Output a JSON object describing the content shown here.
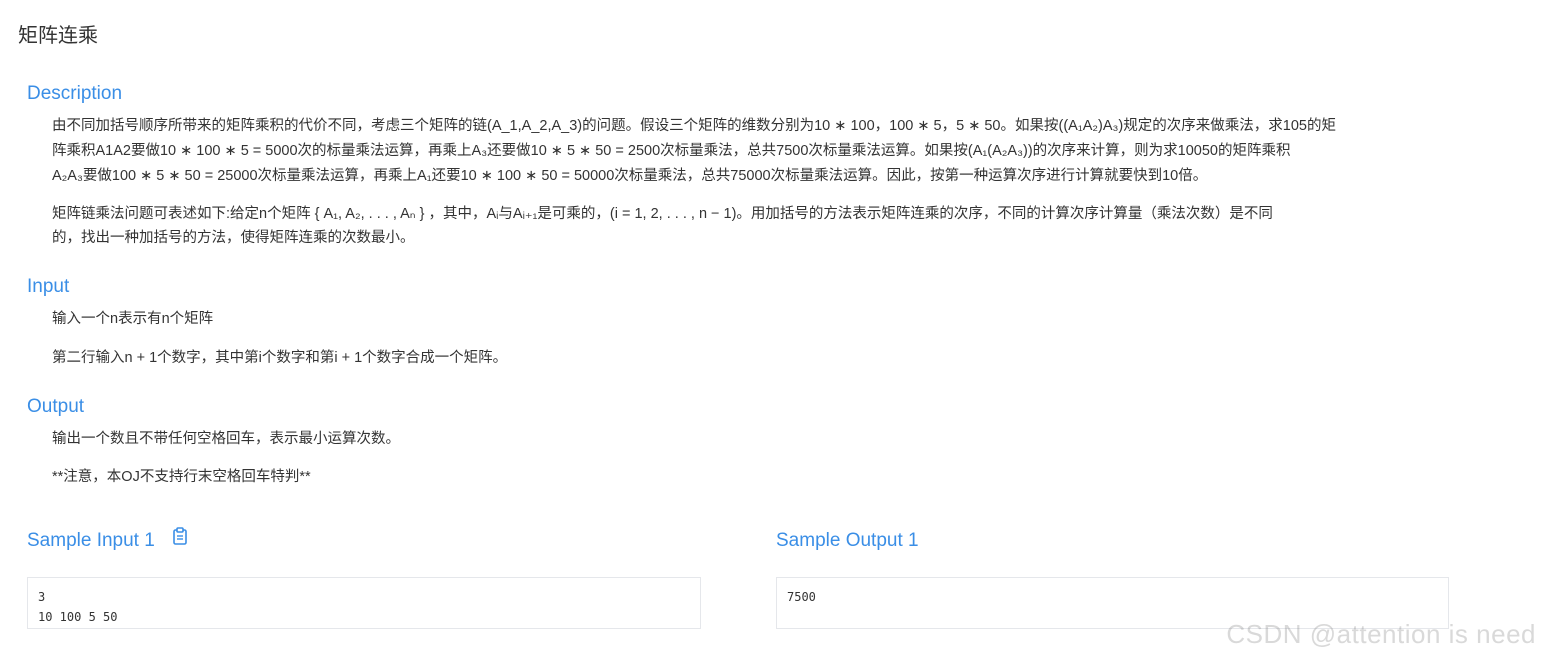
{
  "problem": {
    "title": "矩阵连乘"
  },
  "description": {
    "heading": "Description",
    "para1_lines": [
      "由不同加括号顺序所带来的矩阵乘积的代价不同，考虑三个矩阵的链(A_1,A_2,A_3)的问题。假设三个矩阵的维数分别为10 ∗ 100，100 ∗ 5，5 ∗ 50。如果按((A₁A₂)A₃)规定的次序来做乘法，求105的矩",
      "阵乘积A1A2要做10 ∗ 100 ∗ 5 = 5000次的标量乘法运算，再乘上A₃还要做10 ∗ 5 ∗ 50 = 2500次标量乘法，总共7500次标量乘法运算。如果按(A₁(A₂A₃))的次序来计算，则为求10050的矩阵乘积",
      "A₂A₃要做100 ∗ 5 ∗ 50 = 25000次标量乘法运算，再乘上A₁还要10 ∗ 100 ∗ 50 = 50000次标量乘法，总共75000次标量乘法运算。因此，按第一种运算次序进行计算就要快到10倍。"
    ],
    "para2_lines": [
      "矩阵链乘法问题可表述如下:给定n个矩阵 { A₁, A₂, . . . , Aₙ } ，其中，Aᵢ与Aᵢ₊₁是可乘的，(i = 1, 2, . . . , n − 1)。用加括号的方法表示矩阵连乘的次序，不同的计算次序计算量（乘法次数）是不同",
      "的，找出一种加括号的方法，使得矩阵连乘的次数最小。"
    ]
  },
  "input": {
    "heading": "Input",
    "line1": "输入一个n表示有n个矩阵",
    "line2": "第二行输入n + 1个数字，其中第i个数字和第i + 1个数字合成一个矩阵。"
  },
  "output": {
    "heading": "Output",
    "line1": "输出一个数且不带任何空格回车，表示最小运算次数。",
    "line2": "**注意，本OJ不支持行末空格回车特判**"
  },
  "sample_input": {
    "heading": "Sample Input 1",
    "copy_icon": "clipboard-icon",
    "lines": [
      "3",
      "10 100 5 50"
    ]
  },
  "sample_output": {
    "heading": "Sample Output 1",
    "lines": [
      "7500"
    ]
  },
  "watermark": {
    "text": "CSDN @attention is need"
  },
  "colors": {
    "heading_blue": "#3a8ee6",
    "text": "#333333",
    "border": "#e5e7eb"
  }
}
